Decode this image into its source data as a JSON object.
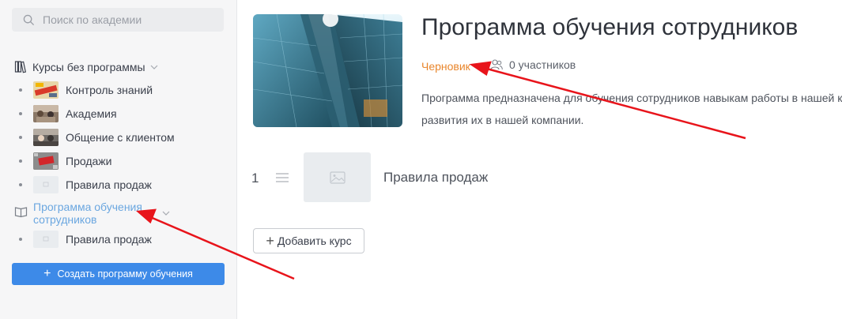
{
  "sidebar": {
    "search_placeholder": "Поиск по академии",
    "group": {
      "label": "Курсы без программы"
    },
    "items": [
      {
        "label": "Контроль знаний",
        "thumb": "thumb-exam"
      },
      {
        "label": "Академия",
        "thumb": "thumb-academy"
      },
      {
        "label": "Общение с клиентом",
        "thumb": "thumb-client"
      },
      {
        "label": "Продажи",
        "thumb": "thumb-sales"
      },
      {
        "label": "Правила продаж",
        "thumb": "thumb-placeholder"
      }
    ],
    "program": {
      "label": "Программа обучения сотрудников"
    },
    "program_items": [
      {
        "label": "Правила продаж",
        "thumb": "thumb-placeholder"
      }
    ],
    "create_button": "Создать программу обучения"
  },
  "main": {
    "title": "Программа обучения сотрудников",
    "status": "Черновик",
    "participants": "0 участников",
    "description_line1": "Программа предназначена для обучения сотрудников навыкам работы в нашей ко",
    "description_line2": "развития их в нашей компании.",
    "courses": [
      {
        "number": "1",
        "name": "Правила продаж"
      }
    ],
    "add_course_button": "Добавить курс"
  },
  "colors": {
    "accent": "#3d8ae8",
    "status": "#e9862c",
    "active_link": "#6ba7e0",
    "annotation_arrow": "#e8141b"
  },
  "icons": [
    "search-icon",
    "library-icon",
    "chevron-down-icon",
    "book-icon",
    "plus-icon",
    "users-icon",
    "drag-handle-icon",
    "image-placeholder-icon"
  ]
}
